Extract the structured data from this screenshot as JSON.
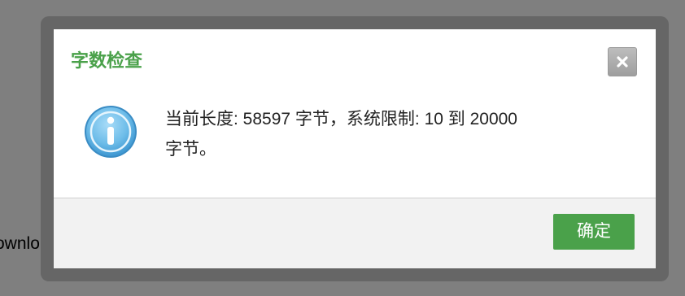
{
  "background": {
    "partial_text": "ownlo"
  },
  "dialog": {
    "title": "字数检查",
    "message_line1": "当前长度: 58597 字节，系统限制: 10 到 20000",
    "message_line2": "字节。",
    "ok_label": "确定",
    "close_icon": "close-icon",
    "message_icon": "info-icon"
  },
  "colors": {
    "title": "#4aa14a",
    "ok_button": "#4aa14a",
    "info_icon": "#5ab2e8",
    "overlay": "#7f7f7f",
    "frame": "#666666"
  }
}
